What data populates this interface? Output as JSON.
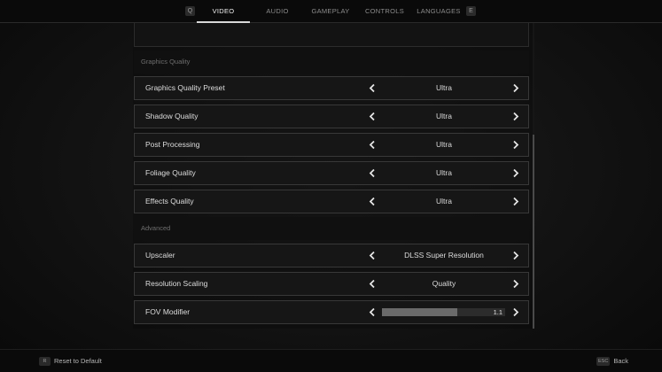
{
  "nav": {
    "key_left": "Q",
    "key_right": "E",
    "tabs": [
      {
        "label": "VIDEO",
        "active": true
      },
      {
        "label": "AUDIO",
        "active": false
      },
      {
        "label": "GAMEPLAY",
        "active": false
      },
      {
        "label": "CONTROLS",
        "active": false
      },
      {
        "label": "LANGUAGES",
        "active": false
      }
    ]
  },
  "sections": {
    "graphics_quality": "Graphics Quality",
    "advanced": "Advanced"
  },
  "rows": {
    "preset": {
      "label": "Graphics Quality Preset",
      "value": "Ultra"
    },
    "shadow": {
      "label": "Shadow Quality",
      "value": "Ultra"
    },
    "post": {
      "label": "Post Processing",
      "value": "Ultra"
    },
    "foliage": {
      "label": "Foliage Quality",
      "value": "Ultra"
    },
    "effects": {
      "label": "Effects Quality",
      "value": "Ultra"
    },
    "upscaler": {
      "label": "Upscaler",
      "value": "DLSS Super Resolution"
    },
    "resolution": {
      "label": "Resolution Scaling",
      "value": "Quality"
    },
    "fov": {
      "label": "FOV Modifier",
      "value": "1.1",
      "fill_fraction": 0.61
    }
  },
  "footer": {
    "reset_key": "R",
    "reset_label": "Reset to Default",
    "back_key": "ESC",
    "back_label": "Back"
  },
  "colors": {
    "background": "#121212",
    "row_border": "#383838",
    "text": "#dedede",
    "accent_underline": "#d8d8d8"
  },
  "icons": [
    "chevron-left-icon",
    "chevron-right-icon"
  ]
}
